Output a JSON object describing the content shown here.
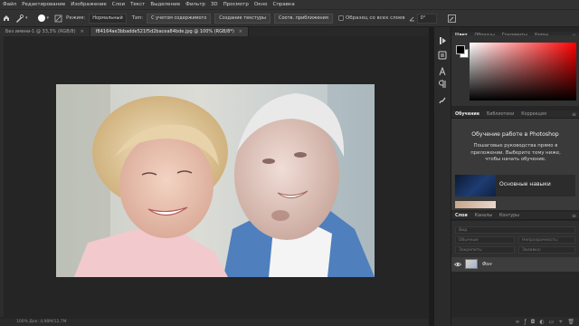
{
  "menubar": [
    "Файл",
    "Редактирование",
    "Изображение",
    "Слои",
    "Текст",
    "Выделение",
    "Фильтр",
    "3D",
    "Просмотр",
    "Окно",
    "Справка"
  ],
  "options": {
    "mode_label": "Режим:",
    "mode_value": "Нормальный",
    "type_label": "Тип:",
    "btn_content_aware": "С учетом содержимого",
    "btn_create_texture": "Создание текстуры",
    "btn_proximity": "Соотв. приближения",
    "sample_all_layers": "Образец со всех слоев",
    "angle_value": "0°"
  },
  "tabs": [
    {
      "label": "Без имени-1 @ 33,3% (RGB/8)",
      "close": "×",
      "active": false
    },
    {
      "label": "f84164ae3bbadde521f5d2bacea84bde.jpg @ 100% (RGB/8*)",
      "close": "×",
      "active": true
    }
  ],
  "status": {
    "text": "100%   Док: 4,98M/12,7M"
  },
  "color_panel": {
    "tabs": [
      "Цвет",
      "Образцы",
      "Градиенты",
      "Узоры"
    ],
    "active": 0
  },
  "learn_panel": {
    "tabs": [
      "Обучение",
      "Библиотеки",
      "Коррекция"
    ],
    "title": "Обучение работе в Photoshop",
    "text": "Пошаговые руководства прямо в приложении. Выберите тему ниже, чтобы начать обучение.",
    "card_label": "Основные навыки"
  },
  "layers_panel": {
    "tabs": [
      "Слои",
      "Каналы",
      "Контуры"
    ],
    "kind_placeholder": "Вид",
    "blend_mode": "Обычные",
    "opacity_label": "Непрозрачность:",
    "lock_label": "Закрепить:",
    "fill_label": "Заливка:",
    "layer_name": "Фон"
  },
  "colors": {
    "accent": "#2f8ae5",
    "panel_bg": "#323232"
  }
}
